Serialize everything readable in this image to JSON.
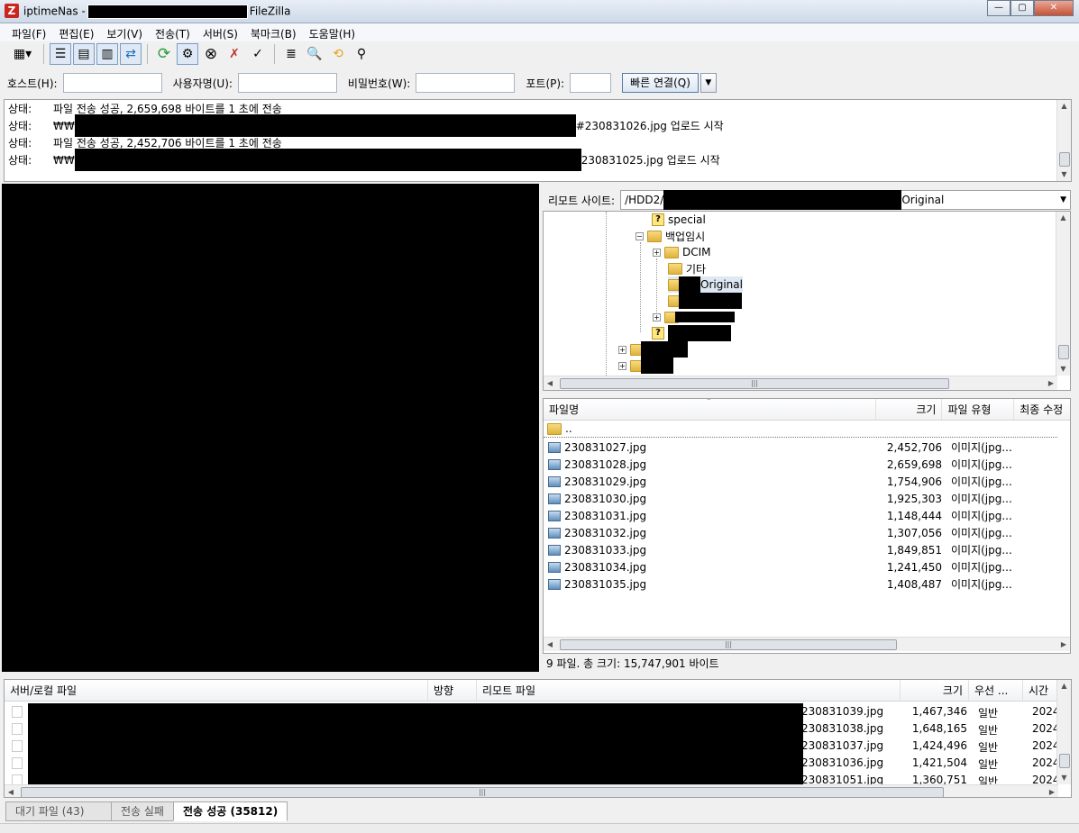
{
  "window": {
    "title_prefix": "iptimeNas -",
    "title_suffix": "FileZilla",
    "app_icon": "Z"
  },
  "menu": [
    "파일(F)",
    "편집(E)",
    "보기(V)",
    "전송(T)",
    "서버(S)",
    "북마크(B)",
    "도움말(H)"
  ],
  "toolbar_icons": [
    "site-manager-icon",
    "toggle-log-icon",
    "toggle-local-tree-icon",
    "toggle-remote-tree-icon",
    "toggle-queue-icon",
    "refresh-icon",
    "process-queue-icon",
    "cancel-icon",
    "disconnect-icon",
    "reconnect-icon",
    "filter-icon",
    "compare-icon",
    "sync-browse-icon",
    "search-icon"
  ],
  "quickconnect": {
    "host_label": "호스트(H):",
    "user_label": "사용자명(U):",
    "pass_label": "비밀번호(W):",
    "port_label": "포트(P):",
    "button": "빠른 연결(Q)",
    "host_value": "",
    "user_value": "",
    "pass_value": "",
    "port_value": ""
  },
  "log": {
    "label": "상태:",
    "lines": [
      {
        "text": "파일 전송 성공, 2,659,698 바이트를 1 초에 전송"
      },
      {
        "prefix": "₩₩",
        "text": "#230831026.jpg 업로드 시작"
      },
      {
        "text": "파일 전송 성공, 2,452,706 바이트를 1 초에 전송"
      },
      {
        "prefix": "₩₩",
        "text": "230831025.jpg 업로드 시작"
      }
    ]
  },
  "remote": {
    "site_label": "리모트 사이트:",
    "path_prefix": "/HDD2/",
    "path_suffix": "Original",
    "tree": {
      "special": "special",
      "backup_temp": "백업임시",
      "dcim": "DCIM",
      "other": "기타",
      "original": "Original"
    }
  },
  "filelist": {
    "headers": {
      "name": "파일명",
      "size": "크기",
      "type": "파일 유형",
      "modified": "최종 수정"
    },
    "parent": "..",
    "files": [
      {
        "name": "230831027.jpg",
        "size": "2,452,706",
        "type": "이미지(jpg..."
      },
      {
        "name": "230831028.jpg",
        "size": "2,659,698",
        "type": "이미지(jpg..."
      },
      {
        "name": "230831029.jpg",
        "size": "1,754,906",
        "type": "이미지(jpg..."
      },
      {
        "name": "230831030.jpg",
        "size": "1,925,303",
        "type": "이미지(jpg..."
      },
      {
        "name": "230831031.jpg",
        "size": "1,148,444",
        "type": "이미지(jpg..."
      },
      {
        "name": "230831032.jpg",
        "size": "1,307,056",
        "type": "이미지(jpg..."
      },
      {
        "name": "230831033.jpg",
        "size": "1,849,851",
        "type": "이미지(jpg..."
      },
      {
        "name": "230831034.jpg",
        "size": "1,241,450",
        "type": "이미지(jpg..."
      },
      {
        "name": "230831035.jpg",
        "size": "1,408,487",
        "type": "이미지(jpg..."
      }
    ],
    "summary": "9 파일. 총 크기: 15,747,901 바이트"
  },
  "queue": {
    "headers": {
      "local": "서버/로컬 파일",
      "direction": "방향",
      "remote": "리모트 파일",
      "size": "크기",
      "priority": "우선 ...",
      "time": "시간"
    },
    "rows": [
      {
        "remote": "230831039.jpg",
        "size": "1,467,346",
        "priority": "일반",
        "time": "2024"
      },
      {
        "remote": "230831038.jpg",
        "size": "1,648,165",
        "priority": "일반",
        "time": "2024"
      },
      {
        "remote": "230831037.jpg",
        "size": "1,424,496",
        "priority": "일반",
        "time": "2024"
      },
      {
        "remote": "230831036.jpg",
        "size": "1,421,504",
        "priority": "일반",
        "time": "2024"
      },
      {
        "remote": "230831051.jpg",
        "size": "1,360,751",
        "priority": "일반",
        "time": "2024"
      }
    ]
  },
  "tabs": [
    {
      "label": "대기 파일 (43)",
      "active": false
    },
    {
      "label": "전송 실패",
      "active": false
    },
    {
      "label": "전송 성공 (35812)",
      "active": true
    }
  ]
}
